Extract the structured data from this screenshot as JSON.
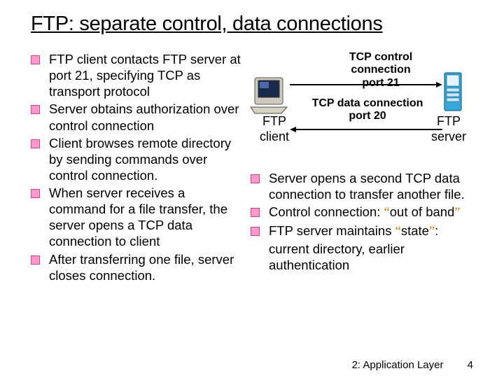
{
  "title": "FTP: separate control, data connections",
  "left_bullets": [
    "FTP client contacts FTP server at port 21, specifying TCP as transport protocol",
    "Server obtains authorization over control connection",
    "Client browses remote directory by sending commands over control connection.",
    "When server receives a command for a file transfer, the server opens a TCP data connection to client",
    "After transferring one file, server closes connection."
  ],
  "right_bullets": [
    "Server opens a second TCP data connection to transfer another file.",
    "Control connection: “out of band”",
    "FTP server maintains “state”: current directory, earlier authentication"
  ],
  "diagram": {
    "tcp_control_l1": "TCP control connection",
    "tcp_control_l2": "port 21",
    "tcp_data_l1": "TCP data connection",
    "tcp_data_l2": "port 20",
    "ftp_client_l1": "FTP",
    "ftp_client_l2": "client",
    "ftp_server_l1": "FTP",
    "ftp_server_l2": "server"
  },
  "footer": {
    "chapter": "2: Application Layer",
    "page": "4"
  }
}
